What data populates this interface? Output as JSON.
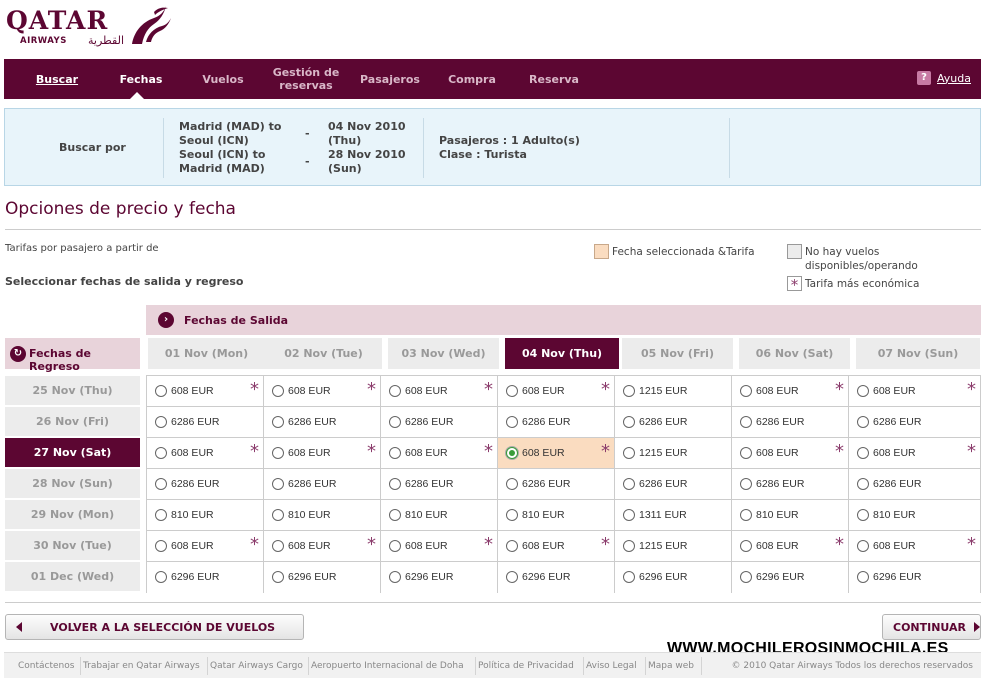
{
  "brand": {
    "name": "QATAR",
    "sub": "AIRWAYS",
    "arabic": "القطرية"
  },
  "nav": {
    "items": [
      "Buscar",
      "Fechas",
      "Vuelos",
      "Gestión de reservas",
      "Pasajeros",
      "Compra",
      "Reserva"
    ],
    "active": "Fechas",
    "help_label": "Ayuda",
    "help_icon": "question-icon"
  },
  "summary": {
    "label": "Buscar por",
    "outbound_route": "Madrid (MAD) to Seoul (ICN)",
    "outbound_dash": "-",
    "outbound_date": "04 Nov 2010 (Thu)",
    "return_route": "Seoul (ICN) to Madrid (MAD)",
    "return_dash": "-",
    "return_date": "28 Nov 2010 (Sun)",
    "pasajeros": "Pasajeros : 1 Adulto(s)",
    "clase": "Clase : Turista"
  },
  "page_title": "Opciones de precio y fecha",
  "tarifas_text": "Tarifas por pasajero a partir de",
  "select_text": "Seleccionar fechas de salida y regreso",
  "legend": {
    "selected": "Fecha seleccionada &Tarifa",
    "no_flights_1": "No hay vuelos",
    "no_flights_2": "disponibles/operando",
    "cheapest": "Tarifa más económica",
    "selected_color": "#fadcc0",
    "no_flights_color": "#ececec"
  },
  "salida_label": "Fechas de Salida",
  "regreso_label": "Fechas de Regreso",
  "departure_dates": [
    "01 Nov (Mon)",
    "02 Nov (Tue)",
    "03 Nov (Wed)",
    "04 Nov (Thu)",
    "05 Nov (Fri)",
    "06 Nov (Sat)",
    "07 Nov (Sun)"
  ],
  "return_dates": [
    "25 Nov (Thu)",
    "26 Nov (Fri)",
    "27 Nov (Sat)",
    "28 Nov (Sun)",
    "29 Nov (Mon)",
    "30 Nov (Tue)",
    "01 Dec (Wed)"
  ],
  "selected_departure": 3,
  "selected_return": 2,
  "grid": [
    [
      {
        "price": "608 EUR",
        "star": true
      },
      {
        "price": "608 EUR",
        "star": true
      },
      {
        "price": "608 EUR",
        "star": true
      },
      {
        "price": "608 EUR",
        "star": true
      },
      {
        "price": "1215 EUR",
        "star": false
      },
      {
        "price": "608 EUR",
        "star": true
      },
      {
        "price": "608 EUR",
        "star": true
      }
    ],
    [
      {
        "price": "6286 EUR",
        "star": false
      },
      {
        "price": "6286 EUR",
        "star": false
      },
      {
        "price": "6286 EUR",
        "star": false
      },
      {
        "price": "6286 EUR",
        "star": false
      },
      {
        "price": "6286 EUR",
        "star": false
      },
      {
        "price": "6286 EUR",
        "star": false
      },
      {
        "price": "6286 EUR",
        "star": false
      }
    ],
    [
      {
        "price": "608 EUR",
        "star": true
      },
      {
        "price": "608 EUR",
        "star": true
      },
      {
        "price": "608 EUR",
        "star": true
      },
      {
        "price": "608 EUR",
        "star": true
      },
      {
        "price": "1215 EUR",
        "star": false
      },
      {
        "price": "608 EUR",
        "star": true
      },
      {
        "price": "608 EUR",
        "star": true
      }
    ],
    [
      {
        "price": "6286 EUR",
        "star": false
      },
      {
        "price": "6286 EUR",
        "star": false
      },
      {
        "price": "6286 EUR",
        "star": false
      },
      {
        "price": "6286 EUR",
        "star": false
      },
      {
        "price": "6286 EUR",
        "star": false
      },
      {
        "price": "6286 EUR",
        "star": false
      },
      {
        "price": "6286 EUR",
        "star": false
      }
    ],
    [
      {
        "price": "810 EUR",
        "star": false
      },
      {
        "price": "810 EUR",
        "star": false
      },
      {
        "price": "810 EUR",
        "star": false
      },
      {
        "price": "810 EUR",
        "star": false
      },
      {
        "price": "1311 EUR",
        "star": false
      },
      {
        "price": "810 EUR",
        "star": false
      },
      {
        "price": "810 EUR",
        "star": false
      }
    ],
    [
      {
        "price": "608 EUR",
        "star": true
      },
      {
        "price": "608 EUR",
        "star": true
      },
      {
        "price": "608 EUR",
        "star": true
      },
      {
        "price": "608 EUR",
        "star": true
      },
      {
        "price": "1215 EUR",
        "star": false
      },
      {
        "price": "608 EUR",
        "star": true
      },
      {
        "price": "608 EUR",
        "star": true
      }
    ],
    [
      {
        "price": "6296 EUR",
        "star": false
      },
      {
        "price": "6296 EUR",
        "star": false
      },
      {
        "price": "6296 EUR",
        "star": false
      },
      {
        "price": "6296 EUR",
        "star": false
      },
      {
        "price": "6296 EUR",
        "star": false
      },
      {
        "price": "6296 EUR",
        "star": false
      },
      {
        "price": "6296 EUR",
        "star": false
      }
    ]
  ],
  "star_glyph": "*",
  "buttons": {
    "back": "VOLVER A LA SELECCIÓN DE VUELOS",
    "continue": "CONTINUAR"
  },
  "watermark": "WWW.MOCHILEROSINMOCHILA.ES",
  "footer": {
    "links": [
      "Contáctenos",
      "Trabajar en Qatar Airways",
      "Qatar Airways Cargo",
      "Aeropuerto Internacional de Doha",
      "Política de Privacidad",
      "Aviso Legal",
      "Mapa web"
    ],
    "copyright": "© 2010 Qatar Airways Todos los derechos reservados"
  },
  "colors": {
    "brand": "#5c0632",
    "summary_bg": "#e8f4fa",
    "selected_cell": "#fadcc0"
  }
}
